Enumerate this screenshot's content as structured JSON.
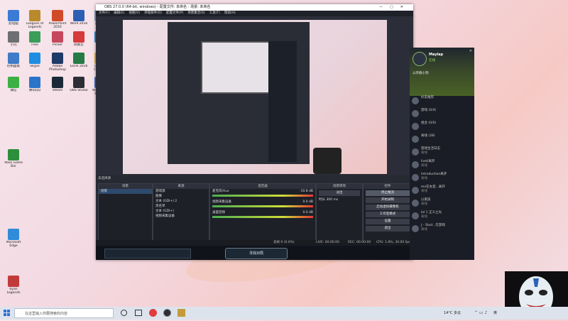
{
  "desktop": {
    "icons": [
      {
        "label": "此电脑",
        "color": "#3b7bd6"
      },
      {
        "label": "Leagues of Legends",
        "color": "#b98a2c"
      },
      {
        "label": "PowerPoint 2016",
        "color": "#d04a2a"
      },
      {
        "label": "Word 2016",
        "color": "#2b5fb4"
      },
      {
        "label": "回收站",
        "color": "#8aa3c4"
      },
      {
        "label": "小闪",
        "color": "#6d6f73"
      },
      {
        "label": "Free",
        "color": "#3a9d5a"
      },
      {
        "label": "Pinner",
        "color": "#c5475c"
      },
      {
        "label": "网易云",
        "color": "#d63a3a"
      },
      {
        "label": "QQ",
        "color": "#2b8ae0"
      },
      {
        "label": "控制面板",
        "color": "#3f7bc7"
      },
      {
        "label": "Skype",
        "color": "#1f8ee0"
      },
      {
        "label": "Adobe Photoshop",
        "color": "#1f3a66"
      },
      {
        "label": "Excel 2016",
        "color": "#257a45"
      },
      {
        "label": "Google Chrome",
        "color": "#e2b33c"
      },
      {
        "label": "微信",
        "color": "#3cb043"
      },
      {
        "label": "腾讯QQ",
        "color": "#2a74c9"
      },
      {
        "label": "Steam",
        "color": "#1b2838"
      },
      {
        "label": "OBS Studio",
        "color": "#2d2d35"
      },
      {
        "label": "Wallpaper Engine",
        "color": "#3a68c9"
      },
      {
        "label": "Xbox Game Bar",
        "color": "#2d8f3c"
      },
      {
        "label": "Microsoft Edge",
        "color": "#2f8cd8"
      },
      {
        "label": "Ryan Legends",
        "color": "#c23b3b"
      }
    ]
  },
  "obs": {
    "title": "OBS 27.0.0 (64-bit, windows) - 配置文件: 未命名 - 场景: 未命名",
    "menu": [
      "文件(F)",
      "编辑(E)",
      "视图(V)",
      "停靠部件(D)",
      "配置文件(P)",
      "场景集合(S)",
      "工具(T)",
      "帮助(H)"
    ],
    "no_source": "未选择源",
    "docks": {
      "scenes": {
        "header": "场景",
        "items": [
          "场景"
        ]
      },
      "sources": {
        "header": "来源",
        "items": [
          "游戏源",
          "图像",
          "文本 (GDI+) 2",
          "黑名单",
          "文本 (GDI+)",
          "视频采集设备"
        ]
      },
      "mixer": {
        "header": "混音器",
        "tracks": [
          {
            "name": "麦克风/Aux",
            "db": "-10.8 dB"
          },
          {
            "name": "视频采集设备",
            "db": "0.0 dB"
          },
          {
            "name": "桌面音频",
            "db": "0.0 dB"
          }
        ]
      },
      "transitions": {
        "header": "场景转场",
        "type": "淡出",
        "duration_label": "时长",
        "duration": "300 ms"
      },
      "controls": {
        "header": "控件",
        "buttons": [
          "停止推流",
          "开始录制",
          "启动虚拟摄像机",
          "工作室模式",
          "设置",
          "退出"
        ]
      }
    },
    "status": {
      "live": "LIVE: 00:00:00",
      "rec": "REC: 00:00:00",
      "cpu": "CPU: 1.8%, 30.00 fps",
      "dropped": "丢帧 0 (0.0%)"
    },
    "gamebar_button": "寻找对局"
  },
  "chat": {
    "username": "Maylap",
    "status": "在线",
    "group": "公开群小刻",
    "messages": [
      {
        "title": "好友推荐",
        "sub": ""
      },
      {
        "title": "游戏 (0/4)",
        "sub": ""
      },
      {
        "title": "组合 (0/0)",
        "sub": ""
      },
      {
        "title": "离线 (28)",
        "sub": ""
      },
      {
        "title": "游戏生活日志",
        "sub": "离线"
      },
      {
        "title": "liveli离开",
        "sub": "离线"
      },
      {
        "title": "Introduction离开",
        "sub": "离线"
      },
      {
        "title": "mo在办室...离开",
        "sub": "离线"
      },
      {
        "title": "以家族",
        "sub": "离线"
      },
      {
        "title": "lol 1 正义之光",
        "sub": "离线"
      },
      {
        "title": "J - Stud...在游戏",
        "sub": "离线"
      }
    ]
  },
  "taskbar": {
    "search_placeholder": "在这里输入你要搜索的内容",
    "weather": "14°C 多云",
    "time": "",
    "lang": "英"
  }
}
